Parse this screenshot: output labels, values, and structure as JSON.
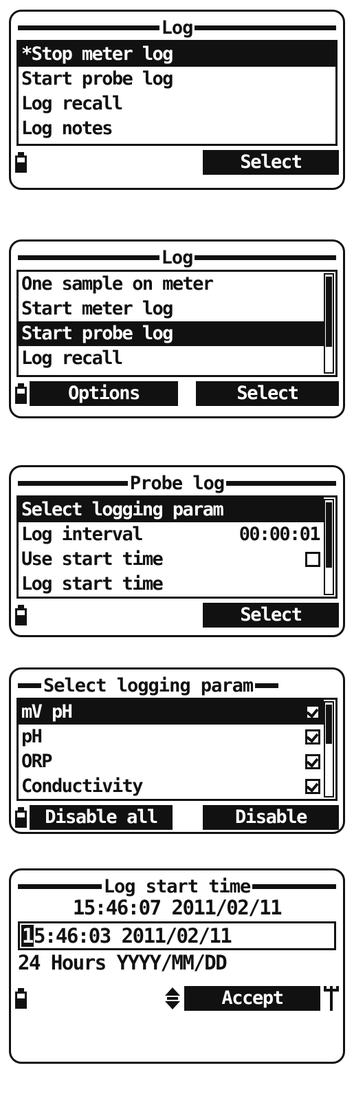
{
  "device": {
    "icons": {
      "battery": "battery-icon",
      "updown": "up-down-arrow-icon",
      "probe": "probe-icon"
    },
    "colors": {
      "foreground": "#111111",
      "background": "#ffffff"
    }
  },
  "screens": [
    {
      "id": "log-menu-1",
      "title": "Log",
      "rows": [
        {
          "label": "*Stop meter log",
          "selected": true
        },
        {
          "label": "Start probe log",
          "selected": false
        },
        {
          "label": "Log recall",
          "selected": false
        },
        {
          "label": "Log notes",
          "selected": false
        }
      ],
      "scrollbar": false,
      "softkeys": {
        "left": null,
        "right": "Select"
      }
    },
    {
      "id": "log-menu-2",
      "title": "Log",
      "rows": [
        {
          "label": "One sample on meter",
          "selected": false
        },
        {
          "label": "Start meter log",
          "selected": false
        },
        {
          "label": "Start probe log",
          "selected": true
        },
        {
          "label": "Log recall",
          "selected": false
        }
      ],
      "scrollbar": true,
      "scroll": {
        "thumb_top_pct": 2,
        "thumb_height_pct": 72
      },
      "softkeys": {
        "left": "Options",
        "right": "Select"
      }
    },
    {
      "id": "probe-log",
      "title": "Probe log",
      "rows": [
        {
          "label": "Select logging param",
          "selected": true
        },
        {
          "label": "Log interval",
          "value": "00:00:01",
          "selected": false
        },
        {
          "label": "Use start time",
          "checkbox": "unchecked",
          "selected": false
        },
        {
          "label": "Log start time",
          "selected": false
        }
      ],
      "scrollbar": true,
      "scroll": {
        "thumb_top_pct": 2,
        "thumb_height_pct": 70
      },
      "softkeys": {
        "left": null,
        "right": "Select"
      }
    },
    {
      "id": "select-logging-param",
      "title": "Select logging param",
      "title_style": "short-rules",
      "rows": [
        {
          "label": "mV pH",
          "checkbox": "checked",
          "selected": true
        },
        {
          "label": "pH",
          "checkbox": "checked",
          "selected": false
        },
        {
          "label": "ORP",
          "checkbox": "checked",
          "selected": false
        },
        {
          "label": "Conductivity",
          "checkbox": "checked",
          "selected": false
        }
      ],
      "scrollbar": true,
      "scroll": {
        "thumb_top_pct": 2,
        "thumb_height_pct": 42
      },
      "softkeys": {
        "left": "Disable all",
        "right": "Disable"
      }
    },
    {
      "id": "log-start-time",
      "title": "Log start time",
      "current_time": "15:46:07 2011/02/11",
      "edit_field": {
        "cursor_char": "1",
        "rest": "5:46:03 2011/02/11"
      },
      "format_line": "24 Hours YYYY/MM/DD",
      "softkeys": {
        "right": "Accept"
      },
      "has_updown": true,
      "has_probe_icon": true
    }
  ]
}
